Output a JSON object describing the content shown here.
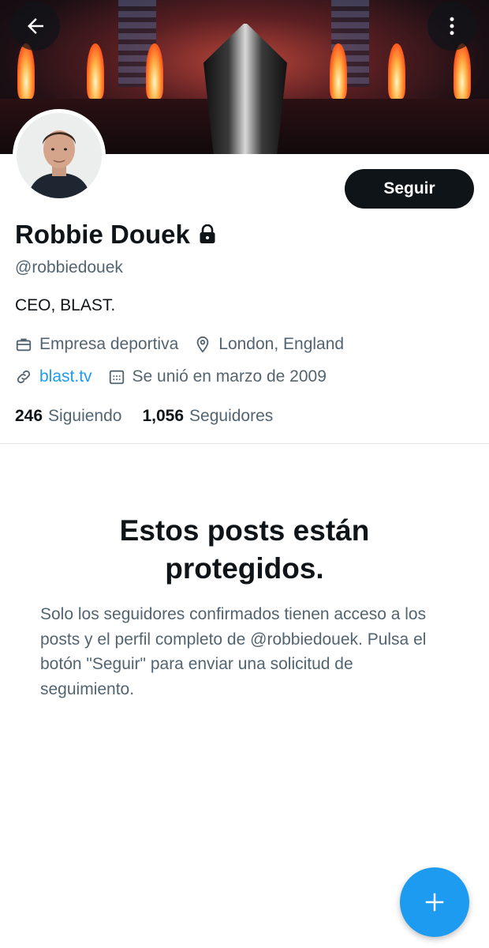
{
  "profile": {
    "display_name": "Robbie Douek",
    "handle": "@robbiedouek",
    "bio": "CEO, BLAST.",
    "category": "Empresa deportiva",
    "location": "London, England",
    "website": "blast.tv",
    "joined": "Se unió en marzo de 2009",
    "following_count": "246",
    "following_label": "Siguiendo",
    "followers_count": "1,056",
    "followers_label": "Seguidores",
    "protected": true
  },
  "actions": {
    "follow_label": "Seguir"
  },
  "protected_notice": {
    "title": "Estos posts están protegidos.",
    "body": "Solo los seguidores confirmados tienen acceso a los posts y el perfil completo de @robbiedouek. Pulsa el botón \"Seguir\" para enviar una solicitud de seguimiento."
  },
  "icons": {
    "back": "arrow-left-icon",
    "more": "more-vertical-icon",
    "lock": "lock-icon",
    "category": "briefcase-icon",
    "location": "location-pin-icon",
    "website": "link-icon",
    "joined": "calendar-icon",
    "compose": "plus-icon"
  },
  "colors": {
    "text_primary": "#0f1419",
    "text_secondary": "#536471",
    "accent": "#1d9bf0",
    "follow_button": "#0f1419"
  }
}
